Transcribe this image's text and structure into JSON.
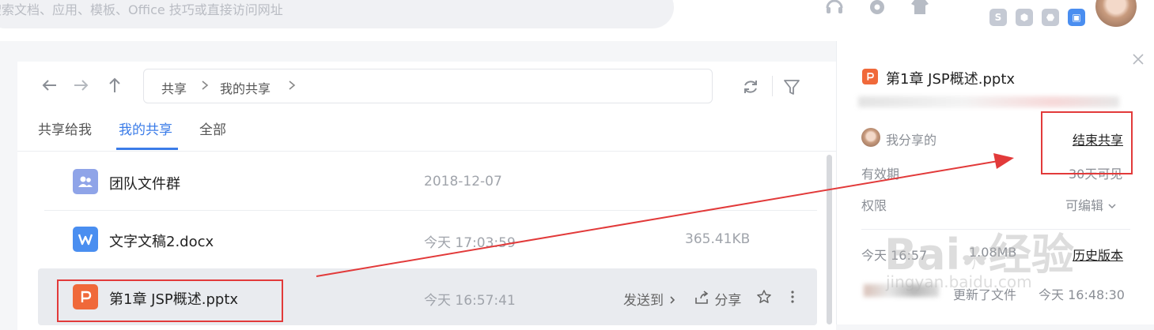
{
  "search": {
    "placeholder": "搜索文档、应用、模板、Office 技巧或直接访问网址"
  },
  "top_badges": [
    "S",
    "⬢",
    "⬣",
    "▣"
  ],
  "nav": {
    "breadcrumb": [
      "共享",
      "我的共享"
    ]
  },
  "tabs": [
    {
      "label": "共享给我",
      "active": false
    },
    {
      "label": "我的共享",
      "active": true
    },
    {
      "label": "全部",
      "active": false
    }
  ],
  "files": [
    {
      "name": "团队文件群",
      "date": "2018-12-07",
      "size": "",
      "icon": "team-folder-icon",
      "icon_color": "#8fa4e8"
    },
    {
      "name": "文字文稿2.docx",
      "date": "今天 17:03:59",
      "size": "365.41KB",
      "icon": "word-doc-icon",
      "icon_color": "#4a8ef0"
    },
    {
      "name": "第1章 JSP概述.pptx",
      "date": "今天 16:57:41",
      "size": "",
      "icon": "ppt-doc-icon",
      "icon_color": "#f0693a"
    }
  ],
  "row_actions": {
    "send_to": "发送到",
    "share": "分享"
  },
  "panel": {
    "title": "第1章 JSP概述.pptx",
    "shared_by": "我分享的",
    "end_share": "结束共享",
    "validity_label": "有效期",
    "validity_value": "30天可见",
    "permission_label": "权限",
    "permission_value": "可编辑",
    "history_left": "今天 16:57",
    "history_size": "1.08MB",
    "history_link": "历史版本",
    "update_text": "更新了文件",
    "update_time": "今天 16:48:30"
  },
  "colors": {
    "accent": "#3b7ce8",
    "annotation": "#e23a3a"
  }
}
